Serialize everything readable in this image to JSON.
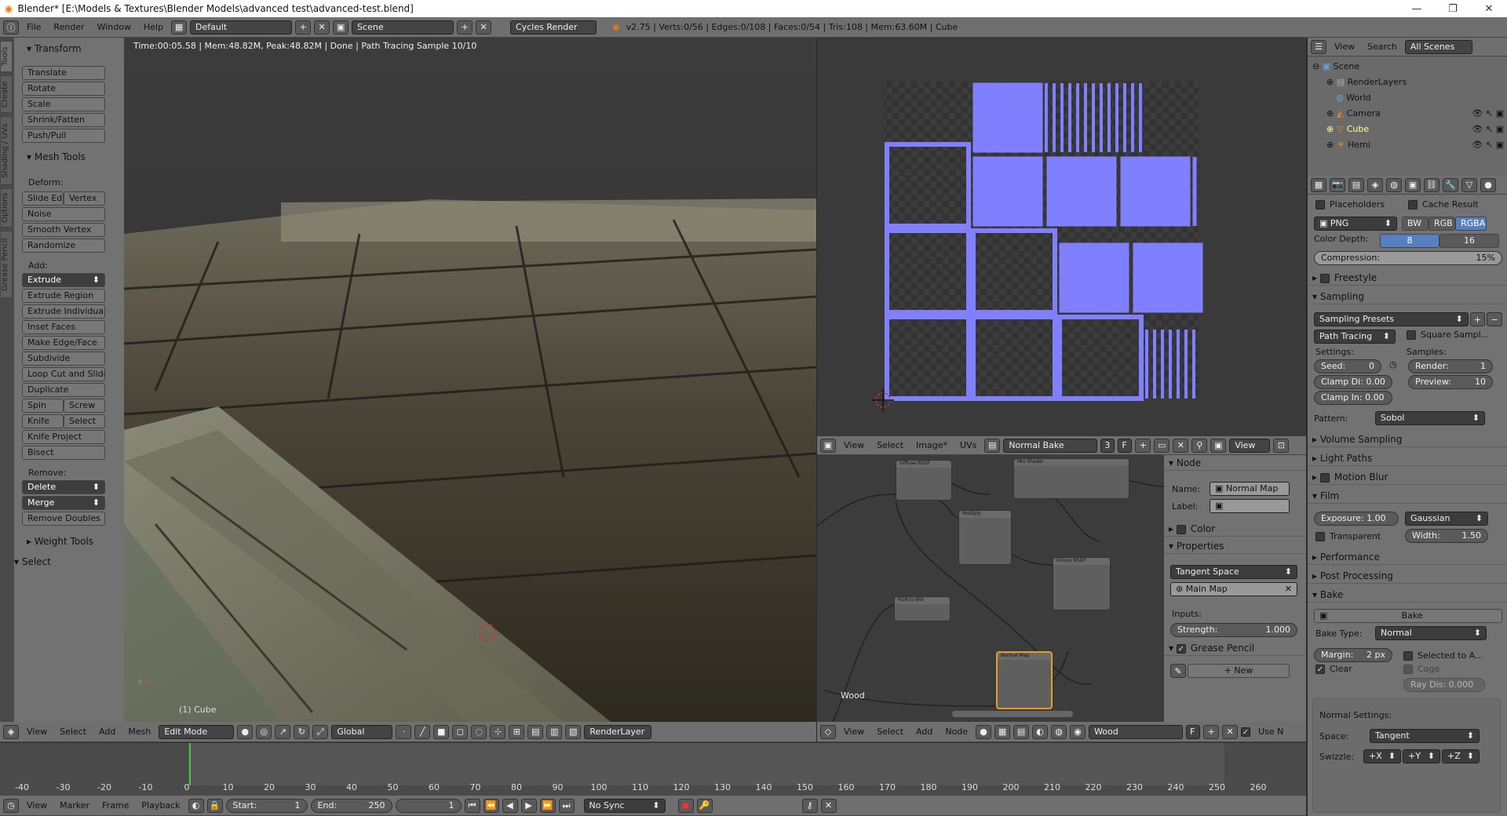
{
  "window": {
    "title": "Blender* [E:\\Models & Textures\\Blender Models\\advanced test\\advanced-test.blend]"
  },
  "topbar": {
    "menus": [
      "File",
      "Render",
      "Window",
      "Help"
    ],
    "layout": "Default",
    "scene": "Scene",
    "engine": "Cycles Render",
    "stats": "v2.75 | Verts:0/56 | Edges:0/108 | Faces:0/54 | Tris:108 | Mem:63.60M | Cube"
  },
  "tool_tabs": [
    "Tools",
    "Create",
    "Shading / UVs",
    "Options",
    "Grease Pencil"
  ],
  "toolshelf": {
    "transform_header": "Transform",
    "transform": [
      "Translate",
      "Rotate",
      "Scale",
      "Shrink/Fatten",
      "Push/Pull"
    ],
    "mesh_tools_header": "Mesh Tools",
    "deform_label": "Deform:",
    "slide_edge": "Slide Ed",
    "vertex": "Vertex",
    "deform": [
      "Noise",
      "Smooth Vertex",
      "Randomize"
    ],
    "add_label": "Add:",
    "extrude": "Extrude",
    "add": [
      "Extrude Region",
      "Extrude Individual",
      "Inset Faces",
      "Make Edge/Face",
      "Subdivide",
      "Loop Cut and Slide",
      "Duplicate"
    ],
    "spin": "Spin",
    "screw": "Screw",
    "knife": "Knife",
    "select": "Select",
    "add2": [
      "Knife Project",
      "Bisect"
    ],
    "remove_label": "Remove:",
    "delete": "Delete",
    "merge": "Merge",
    "remove_doubles": "Remove Doubles",
    "weight_tools": "Weight Tools",
    "select_section": "Select"
  },
  "viewport": {
    "info": "Time:00:05.58 | Mem:48.82M, Peak:48.82M | Done | Path Tracing Sample 10/10",
    "object_label": "(1) Cube",
    "header": {
      "menus": [
        "View",
        "Select",
        "Add",
        "Mesh"
      ],
      "mode": "Edit Mode",
      "orientation": "Global",
      "layer": "RenderLayer"
    }
  },
  "image_editor": {
    "menus": [
      "View",
      "Select",
      "Image*",
      "UVs"
    ],
    "image_name": "Normal Bake",
    "users": "3",
    "fake": "F",
    "view": "View"
  },
  "node_editor": {
    "menus": [
      "View",
      "Select",
      "Add",
      "Node"
    ],
    "material": "Wood",
    "fake": "F",
    "use_nodes": "Use N",
    "corner_label": "Wood",
    "panel": {
      "node_header": "Node",
      "name_label": "Name:",
      "name_value": "Normal Map",
      "label_label": "Label:",
      "color": "Color",
      "properties": "Properties",
      "space": "Tangent Space",
      "map": "Main Map",
      "inputs_label": "Inputs:",
      "strength_label": "Strength:",
      "strength_value": "1.000",
      "grease_pencil": "Grease Pencil",
      "new": "New"
    }
  },
  "outliner": {
    "menus": [
      "View",
      "Search"
    ],
    "filter": "All Scenes",
    "items": [
      "Scene",
      "RenderLayers",
      "World",
      "Camera",
      "Cube",
      "Hemi"
    ]
  },
  "properties": {
    "placeholders": "Placeholders",
    "cache_result": "Cache Result",
    "format": "PNG",
    "bw": "BW",
    "rgb": "RGB",
    "rgba": "RGBA",
    "color_depth_label": "Color Depth:",
    "depth_8": "8",
    "depth_16": "16",
    "compression_label": "Compression:",
    "compression_value": "15%",
    "freestyle": "Freestyle",
    "sampling": "Sampling",
    "sampling_presets": "Sampling Presets",
    "path_tracing": "Path Tracing",
    "square_samples": "Square Sampl...",
    "settings_label": "Settings:",
    "samples_label": "Samples:",
    "seed_label": "Seed:",
    "seed_value": "0",
    "render_label": "Render:",
    "render_value": "1",
    "clamp_direct": "Clamp Di: 0.00",
    "preview_label": "Preview:",
    "preview_value": "10",
    "clamp_indirect": "Clamp In: 0.00",
    "pattern_label": "Pattern:",
    "pattern_value": "Sobol",
    "volume_sampling": "Volume Sampling",
    "light_paths": "Light Paths",
    "motion_blur": "Motion Blur",
    "film": "Film",
    "exposure": "Exposure: 1.00",
    "filter": "Gaussian",
    "transparent": "Transparent",
    "width": "Width:",
    "width_value": "1.50",
    "performance": "Performance",
    "post_processing": "Post Processing",
    "bake_section": "Bake",
    "bake_button": "Bake",
    "bake_type_label": "Bake Type:",
    "bake_type": "Normal",
    "margin": "Margin:",
    "margin_value": "2 px",
    "selected_to_active": "Selected to A...",
    "clear": "Clear",
    "cage": "Cage",
    "ray_distance": "Ray Dis: 0.000",
    "normal_settings": "Normal Settings:",
    "space_label": "Space:",
    "space_value": "Tangent",
    "swizzle_label": "Swizzle:",
    "swizzle": [
      "+X",
      "+Y",
      "+Z"
    ]
  },
  "timeline": {
    "ticks": [
      "-40",
      "-30",
      "-20",
      "-10",
      "0",
      "10",
      "20",
      "30",
      "40",
      "50",
      "60",
      "70",
      "80",
      "90",
      "100",
      "110",
      "120",
      "130",
      "140",
      "150",
      "160",
      "170",
      "180",
      "190",
      "200",
      "210",
      "220",
      "230",
      "240",
      "250",
      "260"
    ],
    "menus": [
      "View",
      "Marker",
      "Frame",
      "Playback"
    ],
    "start_label": "Start:",
    "start_value": "1",
    "end_label": "End:",
    "end_value": "250",
    "current": "1",
    "sync": "No Sync"
  },
  "colors": {
    "uv": "#8080ff",
    "header": "#6f6f6f",
    "panel": "#727272",
    "selected_blue": "#5680c2"
  }
}
